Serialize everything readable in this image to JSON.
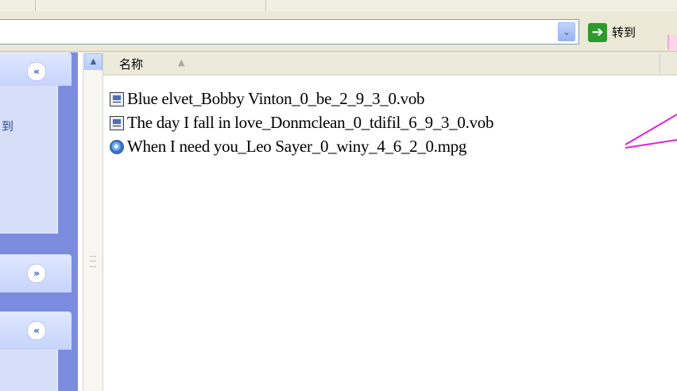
{
  "address_bar": {
    "go_label": "转到",
    "dropdown_glyph": "⌄",
    "go_arrow_glyph": "➔"
  },
  "task_pane": {
    "section_text": "到",
    "chevron_up": "«",
    "chevron_down": "»"
  },
  "file_list": {
    "column_name_label": "名称",
    "sort_glyph": "▲",
    "scroll_up_glyph": "▲",
    "items": [
      {
        "name": "Blue elvet_Bobby Vinton_0_be_2_9_3_0.vob",
        "icon": "video-file-icon"
      },
      {
        "name": "The day I fall in love_Donmclean_0_tdifil_6_9_3_0.vob",
        "icon": "video-file-icon"
      },
      {
        "name": "When I need you_Leo Sayer_0_winy_4_6_2_0.mpg",
        "icon": "media-player-icon"
      }
    ]
  },
  "colors": {
    "task_pane_bg": "#7b8cde",
    "annotation_line": "#e020e0",
    "go_green": "#2d9a2d"
  }
}
